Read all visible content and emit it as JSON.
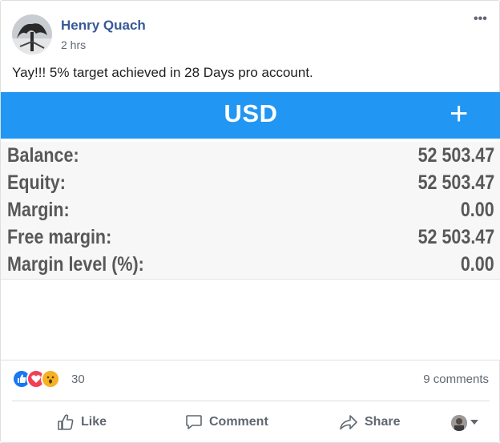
{
  "post": {
    "author": "Henry Quach",
    "time": "2 hrs",
    "text": "Yay!!! 5% target achieved in 28 Days pro account."
  },
  "photo": {
    "currency": "USD",
    "plus_icon": "+",
    "header_color": "#2196f3",
    "rows": [
      {
        "label": "Balance:",
        "value": "52 503.47"
      },
      {
        "label": "Equity:",
        "value": "52 503.47"
      },
      {
        "label": "Margin:",
        "value": "0.00"
      },
      {
        "label": "Free margin:",
        "value": "52 503.47"
      },
      {
        "label": "Margin level (%):",
        "value": "0.00"
      }
    ]
  },
  "reactions": {
    "icons": [
      "like-icon",
      "love-icon",
      "wow-icon"
    ],
    "count": "30",
    "comments": "9 comments"
  },
  "actions": {
    "like": "Like",
    "comment": "Comment",
    "share": "Share"
  }
}
